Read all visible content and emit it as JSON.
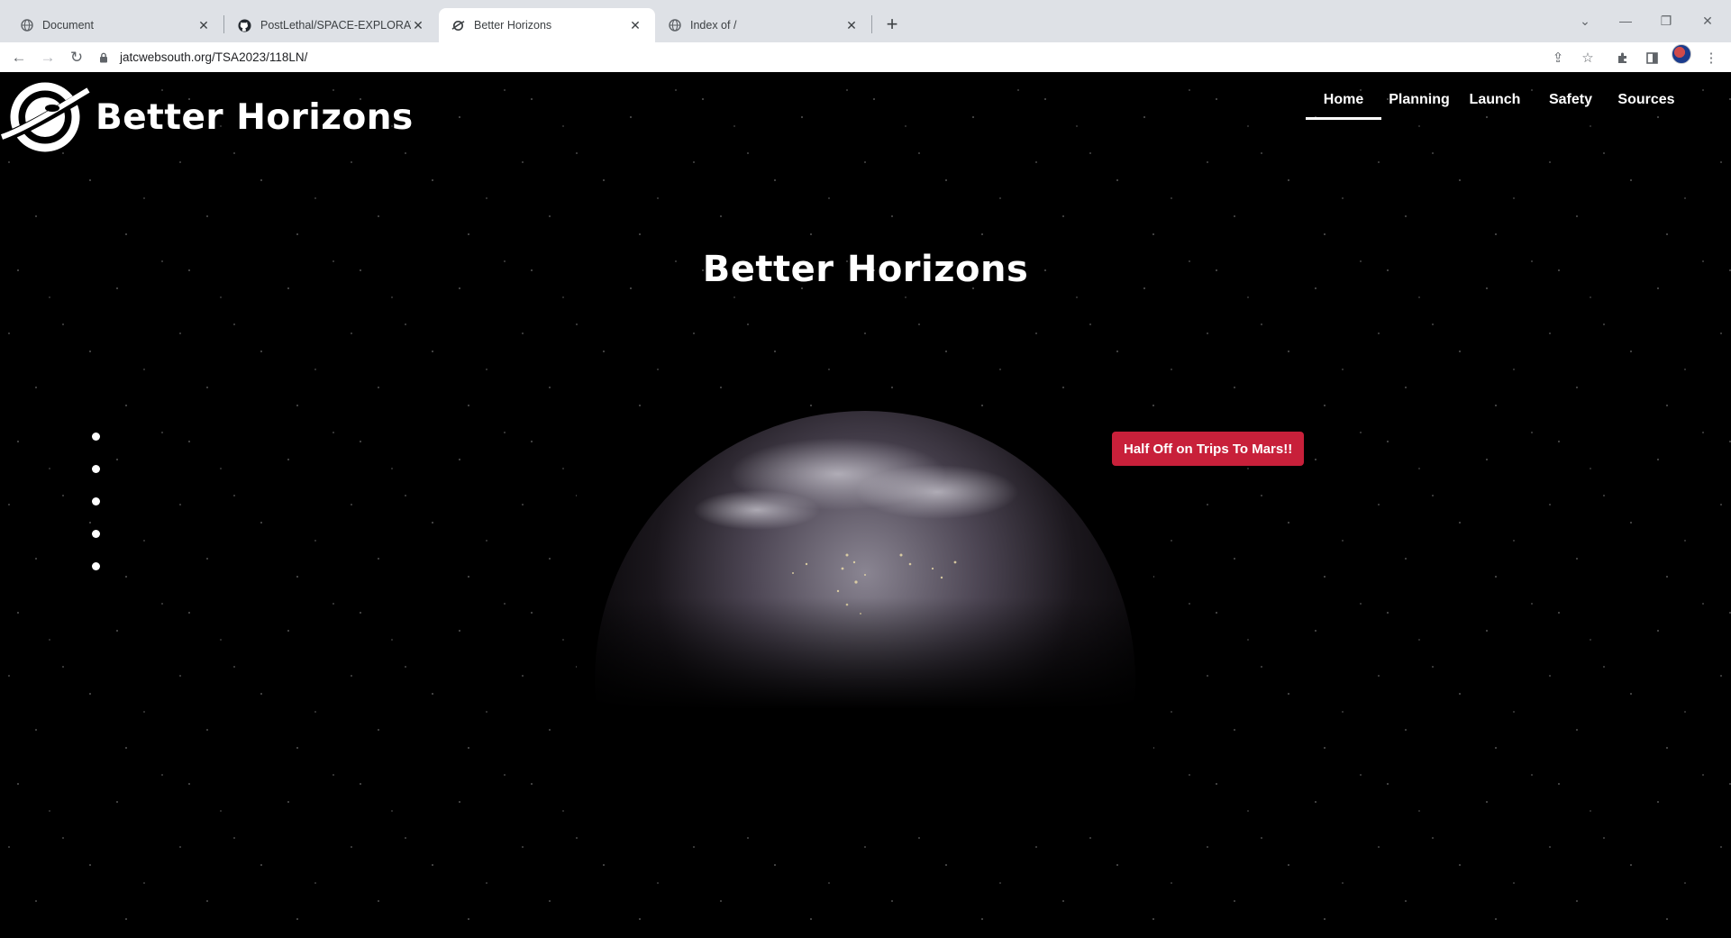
{
  "browser": {
    "tabs": [
      {
        "title": "Document",
        "icon": "globe-icon",
        "active": false
      },
      {
        "title": "PostLethal/SPACE-EXPLORATION",
        "icon": "github-icon",
        "active": false
      },
      {
        "title": "Better Horizons",
        "icon": "site-logo-icon",
        "active": true
      },
      {
        "title": "Index of /",
        "icon": "globe-icon",
        "active": false
      }
    ],
    "url": "jatcwebsouth.org/TSA2023/118LN/"
  },
  "site": {
    "brand": "Better Horizons",
    "nav": [
      {
        "label": "Home",
        "active": true
      },
      {
        "label": "Planning",
        "active": false
      },
      {
        "label": "Launch",
        "active": false
      },
      {
        "label": "Safety",
        "active": false
      },
      {
        "label": "Sources",
        "active": false
      }
    ],
    "hero_title": "Better Horizons",
    "promo_button": "Half Off on Trips To Mars!!",
    "slide_dots": [
      1,
      2,
      3,
      4,
      5
    ],
    "colors": {
      "background": "#000000",
      "promo": "#c8203a",
      "text": "#ffffff"
    }
  }
}
